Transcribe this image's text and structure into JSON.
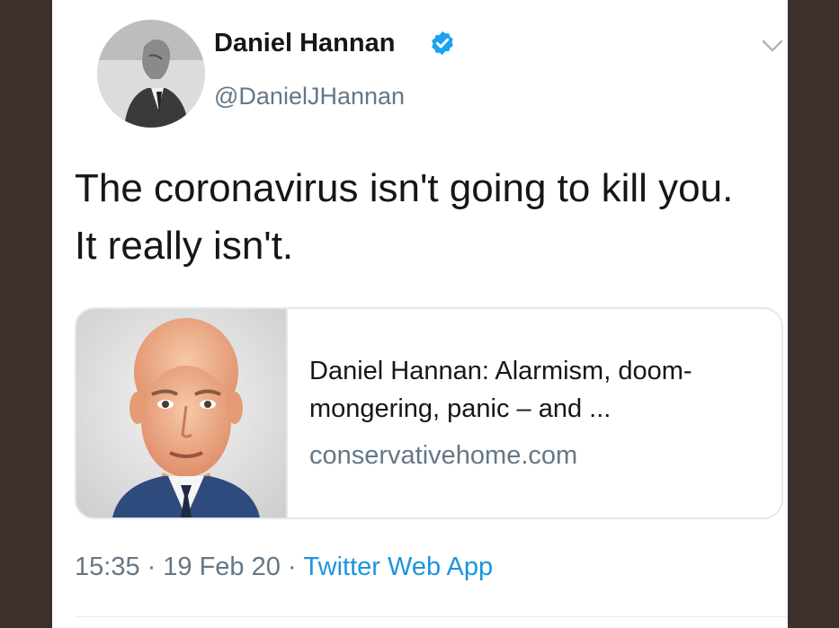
{
  "tweet": {
    "author": {
      "display_name": "Daniel Hannan",
      "handle": "@DanielJHannan",
      "verified": true
    },
    "text": "The coronavirus isn't going to kill you. It really isn't.",
    "card": {
      "title": "Daniel Hannan: Alarmism, doom-mongering, panic – and ...",
      "domain": "conservativehome.com"
    },
    "meta": {
      "time": "15:35",
      "separator": "·",
      "date": "19 Feb 20",
      "source": "Twitter Web App"
    }
  },
  "icons": {
    "verified_badge": "verified-badge-icon",
    "menu_caret": "chevron-down-icon"
  },
  "colors": {
    "text_primary": "#14171a",
    "text_secondary": "#657786",
    "link": "#1b95e0",
    "verified": "#1da1f2",
    "card_border": "#e1e8ed",
    "frame": "#3b302c"
  }
}
